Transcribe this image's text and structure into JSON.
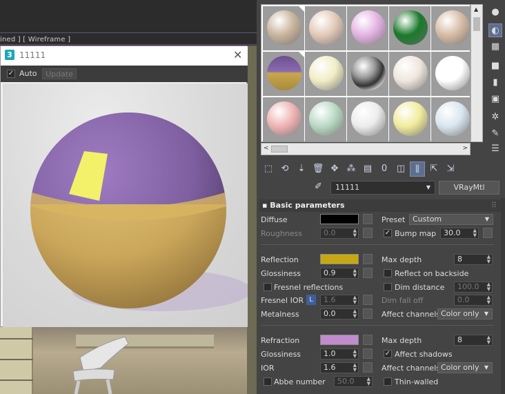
{
  "viewport": {
    "label": "ined ] [ Wireframe ]"
  },
  "render_window": {
    "app_icon": "3",
    "title": "11111",
    "close": "✕",
    "auto_label": "Auto",
    "auto_checked": true,
    "update_label": "Update"
  },
  "material_slots": {
    "balls": [
      "#c9b49d",
      "#e3c9b9",
      "#e3b3e3",
      "#1a7a2a",
      "#d6bba5",
      "active-purple-gold",
      "#f1edc6",
      "chrome",
      "#efe6de",
      "#ffffff",
      "#efb3b3",
      "#b9d9c4",
      "#ececec",
      "#f1ec9c",
      "#d9e6ef"
    ]
  },
  "side_tools": [
    "sphere-icon",
    "background-icon",
    "checker-icon",
    "square-icon",
    "color-bars-icon",
    "video-check-icon",
    "options-icon",
    "pick-icon",
    "list-icon"
  ],
  "material": {
    "name": "11111",
    "type": "VRayMtl"
  },
  "basic": {
    "heading": "Basic parameters",
    "diffuse_label": "Diffuse",
    "diffuse_color": "#000000",
    "preset_label": "Preset",
    "preset_value": "Custom",
    "roughness_label": "Roughness",
    "roughness_value": "0.0",
    "bump_label": "Bump map",
    "bump_value": "30.0",
    "reflection_label": "Reflection",
    "reflection_color": "#c8a812",
    "maxdepth_label": "Max depth",
    "maxdepth_value": "8",
    "glossiness_label": "Glossiness",
    "glossiness_value": "0.9",
    "reflect_backside_label": "Reflect on backside",
    "fresnel_label": "Fresnel reflections",
    "dim_distance_label": "Dim distance",
    "dim_distance_value": "100.0",
    "fresnel_ior_label": "Fresnel IOR",
    "fresnel_ior_lock": "L",
    "fresnel_ior_value": "1.6",
    "dim_falloff_label": "Dim fall off",
    "dim_falloff_value": "0.0",
    "metalness_label": "Metalness",
    "metalness_value": "0.0",
    "affect_channels_label": "Affect channels",
    "affect_channels_value": "Color only",
    "refraction_label": "Refraction",
    "refraction_color": "#c18ccd",
    "rmaxdepth_label": "Max depth",
    "rmaxdepth_value": "8",
    "rglossiness_label": "Glossiness",
    "rglossiness_value": "1.0",
    "affect_shadows_label": "Affect shadows",
    "ior_label": "IOR",
    "ior_value": "1.6",
    "raffect_label": "Affect channels",
    "raffect_value": "Color only",
    "abbe_label": "Abbe number",
    "abbe_value": "50.0",
    "thin_label": "Thin-walled"
  }
}
